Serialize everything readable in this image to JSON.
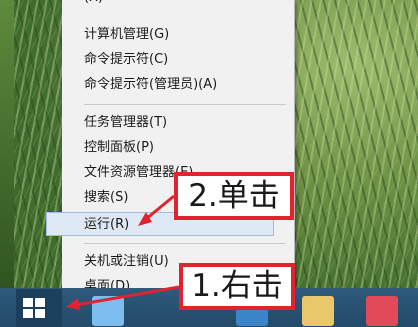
{
  "menu": {
    "items": [
      {
        "label": "计算机管理(G)"
      },
      {
        "label": "命令提示符(C)"
      },
      {
        "label": "命令提示符(管理员)(A)"
      },
      {
        "label": "任务管理器(T)"
      },
      {
        "label": "控制面板(P)"
      },
      {
        "label": "文件资源管理器(E)"
      },
      {
        "label": "搜索(S)"
      },
      {
        "label": "运行(R)"
      },
      {
        "label": "关机或注销(U)"
      },
      {
        "label": "桌面(D)"
      }
    ]
  },
  "annotations": {
    "step1": "1.右击",
    "step2": "2.单击"
  },
  "colors": {
    "annotation": "#e0232e",
    "highlight": "#dfe9f5"
  },
  "taskbar": {
    "icons": [
      "ie-icon",
      "store-icon",
      "file-explorer-icon",
      "app-icon"
    ]
  }
}
